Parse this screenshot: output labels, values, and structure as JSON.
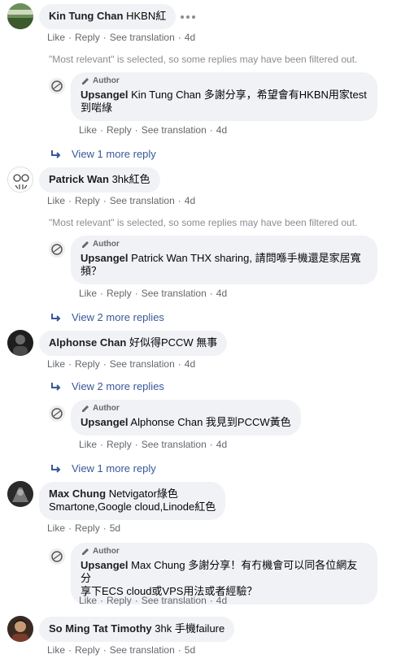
{
  "actions": {
    "like": "Like",
    "reply": "Reply",
    "see_translation": "See translation",
    "sep": "·"
  },
  "notice": "\"Most relevant\" is selected, so some replies may have been filtered out.",
  "author_badge": "Author",
  "comments": [
    {
      "name": "Kin Tung Chan",
      "text": "HKBN紅",
      "time": "4d",
      "reply": {
        "name": "Upsangel",
        "text_line1": "Kin Tung Chan 多謝分享，希望會有HKBN用家test",
        "text_line2": "到啱綠",
        "time": "4d"
      },
      "more": "View 1 more reply"
    },
    {
      "name": "Patrick Wan",
      "text": "3hk紅色",
      "time": "4d",
      "reply": {
        "name": "Upsangel",
        "text_line1": "Patrick Wan THX sharing, 請問喺手機還是家居寬",
        "text_line2": "頻？",
        "time": "4d"
      },
      "more": "View 2 more replies"
    },
    {
      "name": "Alphonse Chan",
      "text": "好似得PCCW 無事",
      "time": "4d",
      "more_before": "View 2 more replies",
      "reply": {
        "name": "Upsangel",
        "text_line1": "Alphonse Chan 我見到PCCW黃色",
        "time": "4d"
      },
      "more": "View 1 more reply"
    },
    {
      "name": "Max Chung",
      "text": "Netvigator綠色",
      "text_line2": "Smartone,Google cloud,Linode紅色",
      "time": "5d",
      "reply": {
        "name": "Upsangel",
        "text_line1": "Max Chung 多謝分享！有冇機會可以同各位網友分",
        "text_line2": "享下ECS cloud或VPS用法或者經驗？",
        "time": "4d"
      }
    },
    {
      "name": "So Ming Tat Timothy",
      "text": "3hk 手機failure",
      "time": "5d"
    }
  ],
  "colors": {
    "link": "#385898",
    "meta": "#65676b",
    "bubble": "#f0f2f5"
  }
}
